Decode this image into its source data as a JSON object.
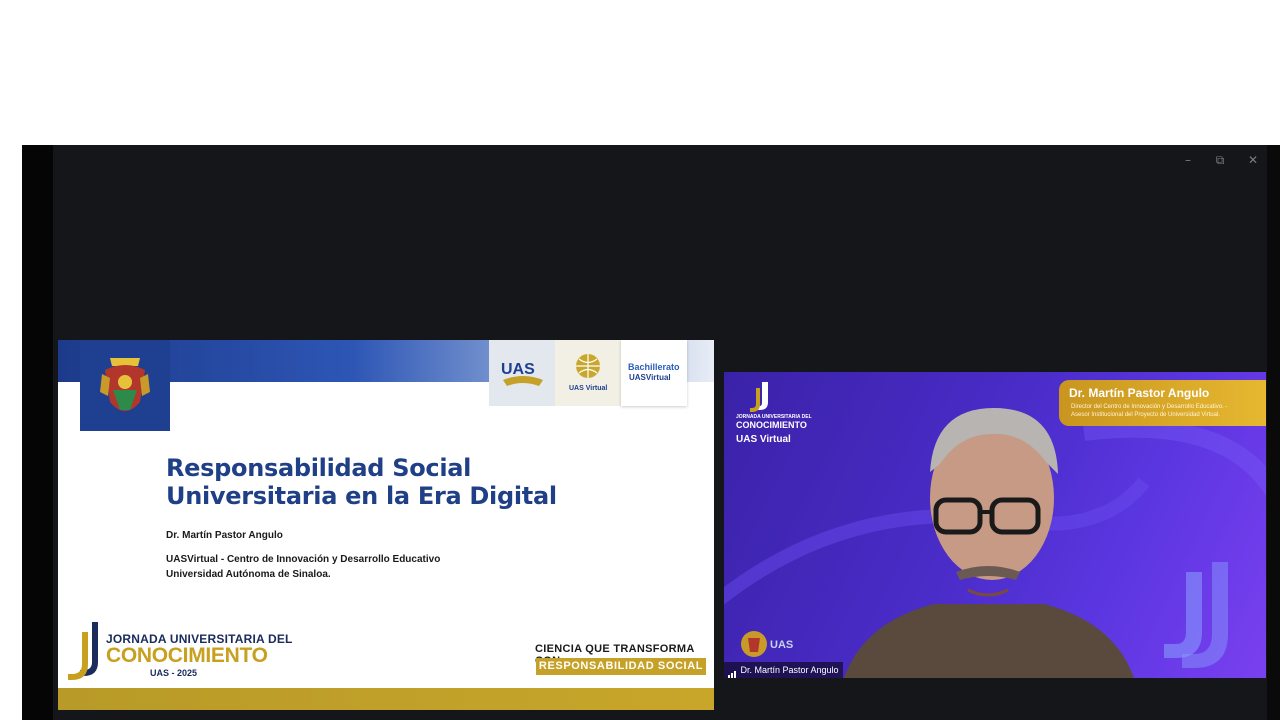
{
  "window": {
    "controls": {
      "minimize": "–",
      "restore": "⧉",
      "close": "✕"
    }
  },
  "slide": {
    "title_line1": "Responsabilidad Social",
    "title_line2": "Universitaria en la Era Digital",
    "author": "Dr. Martín Pastor Angulo",
    "affiliation_line1": "UASVirtual - Centro de Innovación y Desarrollo Educativo",
    "affiliation_line2": "Universidad Autónoma de Sinaloa.",
    "logos": {
      "uas": "UAS",
      "uasvirtual": "UAS Virtual",
      "bachillerato_line1": "Bachillerato",
      "bachillerato_line2": "UASVirtual"
    },
    "jornada": {
      "line1": "JORNADA UNIVERSITARIA DEL",
      "line2": "CONOCIMIENTO",
      "line3": "UAS - 2025"
    },
    "slogan_line1": "CIENCIA QUE TRANSFORMA CON",
    "slogan_line2": "RESPONSABILIDAD SOCIAL"
  },
  "video": {
    "nameplate_name": "Dr. Martín Pastor Angulo",
    "nameplate_role1": "Director del Centro de Innovación y Desarrollo Educativo. -",
    "nameplate_role2": "Asesor Institucional del Proyecto de Universidad Virtual.",
    "logo_line1": "JORNADA UNIVERSITARIA DEL",
    "logo_line2": "CONOCIMIENTO",
    "logo_line3": "UAS Virtual",
    "participant_label": "Dr. Martín Pastor Angulo"
  },
  "colors": {
    "accent_gold": "#c5a128",
    "slide_blue": "#1f3f86",
    "video_purple": "#4a2cc8"
  }
}
